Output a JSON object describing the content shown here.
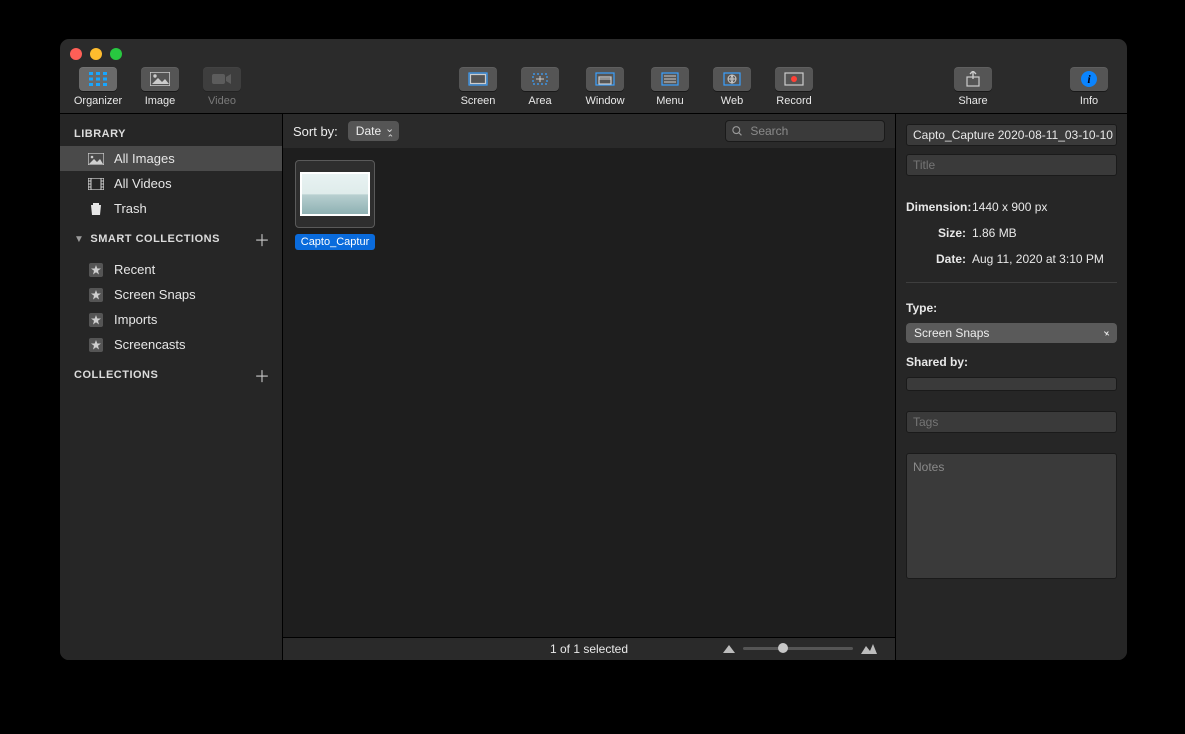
{
  "toolbar": {
    "left": [
      {
        "label": "Organizer"
      },
      {
        "label": "Image"
      },
      {
        "label": "Video"
      }
    ],
    "mid": [
      {
        "label": "Screen"
      },
      {
        "label": "Area"
      },
      {
        "label": "Window"
      },
      {
        "label": "Menu"
      },
      {
        "label": "Web"
      },
      {
        "label": "Record"
      }
    ],
    "share": "Share",
    "info": "Info"
  },
  "sidebar": {
    "library_header": "LIBRARY",
    "library": [
      {
        "label": "All Images"
      },
      {
        "label": "All Videos"
      },
      {
        "label": "Trash"
      }
    ],
    "smart_header": "SMART COLLECTIONS",
    "smart": [
      {
        "label": "Recent"
      },
      {
        "label": "Screen Snaps"
      },
      {
        "label": "Imports"
      },
      {
        "label": "Screencasts"
      }
    ],
    "collections_header": "COLLECTIONS"
  },
  "main": {
    "sort_label": "Sort by:",
    "sort_value": "Date",
    "search_placeholder": "Search",
    "thumb_label": "Capto_Captur",
    "status": "1 of 1 selected"
  },
  "inspector": {
    "filename": "Capto_Capture 2020-08-11_03-10-10",
    "title_placeholder": "Title",
    "dimension_label": "Dimension:",
    "dimension_value": "1440 x 900 px",
    "size_label": "Size:",
    "size_value": "1.86 MB",
    "date_label": "Date:",
    "date_value": "Aug 11, 2020 at 3:10 PM",
    "type_label": "Type:",
    "type_value": "Screen Snaps",
    "shared_label": "Shared by:",
    "tags_placeholder": "Tags",
    "notes_placeholder": "Notes"
  }
}
